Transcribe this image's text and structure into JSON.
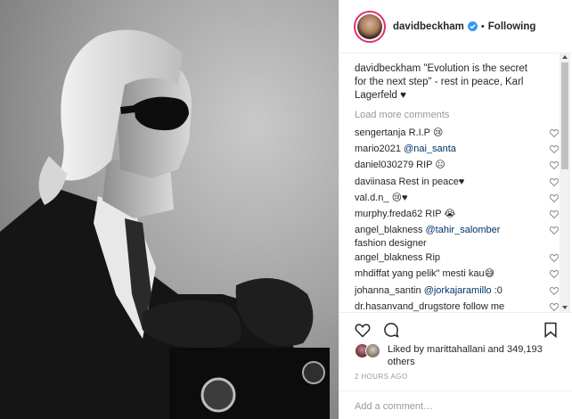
{
  "post": {
    "username": "davidbeckham",
    "follow_state": "Following",
    "separator": "•",
    "caption_text": "\"Evolution is the secret for the next step\" - rest in peace, Karl Lagerfeld ♥",
    "load_more": "Load more comments"
  },
  "comments": [
    {
      "user": "sengertanja",
      "text": "R.I.P 😢",
      "mention": ""
    },
    {
      "user": "mario2021",
      "text": "",
      "mention": "@nai_santa"
    },
    {
      "user": "daniel030279",
      "text": "RIP ☹",
      "mention": ""
    },
    {
      "user": "daviinasa",
      "text": "Rest in peace♥",
      "mention": ""
    },
    {
      "user": "val.d.n_",
      "text": "😢♥",
      "mention": ""
    },
    {
      "user": "murphy.freda62",
      "text": "RIP 😭",
      "mention": ""
    },
    {
      "user": "angel_blakness",
      "text": " fashion designer",
      "mention": "@tahir_salomber"
    },
    {
      "user": "angel_blakness",
      "text": "Rip",
      "mention": ""
    },
    {
      "user": "mhdiffat",
      "text": "yang pelik\" mesti kau😅",
      "mention": ""
    },
    {
      "user": "johanna_santin",
      "text": " :0",
      "mention": "@jorkajaramillo"
    },
    {
      "user": "dr.hasanvand_drugstore",
      "text": "follow me",
      "mention": ""
    }
  ],
  "likes": {
    "text_prefix": "Liked by",
    "liker": "marittahallani",
    "text_suffix": "and",
    "count": "349,193 others"
  },
  "timestamp": "2 HOURS AGO",
  "add_comment_placeholder": "Add a comment…",
  "colors": {
    "text": "#262626",
    "muted": "#999999",
    "mention": "#003569",
    "verified": "#3897f0",
    "border": "#efefef"
  },
  "icons": {
    "verified": "verified-badge-icon",
    "comment_like": "heart-outline-icon",
    "like": "heart-outline-icon",
    "comment": "comment-bubble-icon",
    "save": "bookmark-icon"
  }
}
